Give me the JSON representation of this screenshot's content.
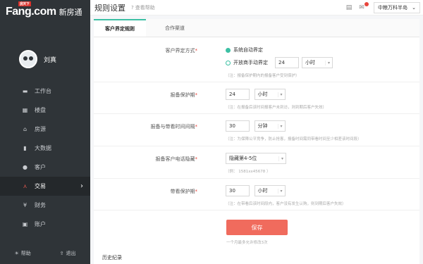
{
  "brand": {
    "tiny": "房天下",
    "name": "Fang.com",
    "sub": "新房通"
  },
  "user": {
    "name": "刘真"
  },
  "sidebar": {
    "items": [
      {
        "label": "工作台",
        "icon": "monitor-icon"
      },
      {
        "label": "楼盘",
        "icon": "building-icon"
      },
      {
        "label": "房源",
        "icon": "house-icon"
      },
      {
        "label": "大数据",
        "icon": "chart-icon"
      },
      {
        "label": "客户",
        "icon": "person-icon"
      },
      {
        "label": "交易",
        "icon": "handshake-icon",
        "active": true
      },
      {
        "label": "财务",
        "icon": "money-icon"
      },
      {
        "label": "账户",
        "icon": "account-icon"
      }
    ],
    "footer": {
      "help": "帮助",
      "logout": "退出"
    }
  },
  "header": {
    "title": "规则设置",
    "help": "查看帮助",
    "city": "中粮万科半岛"
  },
  "tabs": [
    {
      "label": "客户界定规则",
      "active": true
    },
    {
      "label": "合作渠道"
    }
  ],
  "form": {
    "define": {
      "label": "客户界定方式",
      "option1": "系统自动界定",
      "option2": "开放商手动界定",
      "value": "24",
      "unit": "小时",
      "hint": "（注：报备保护期内的报备客户受到保护）"
    },
    "protect": {
      "label": "报备保护期",
      "value": "24",
      "unit": "小时",
      "hint": "（注：在报备后该时间报客户未到访，则到期后客户失效）"
    },
    "interval": {
      "label": "报备与带看时间间隔",
      "value": "30",
      "unit": "分钟",
      "hint": "（注：为保障公平竞争，防止抢客，报备时间需同带看时间至少相差该时间段）"
    },
    "phone": {
      "label": "报备客户电话隐藏",
      "value": "隐藏第4-5位",
      "hint": "（例：  1581xx45678  ）"
    },
    "visit": {
      "label": "带看保护期",
      "value": "30",
      "unit": "小时",
      "hint": "（注：在带看后该时间段内，客户没有发生认购，则到期后客户失效）"
    },
    "save": "保存",
    "save_hint": "一个月最多允许修改3次",
    "history": "历史纪录"
  },
  "colors": {
    "accent": "#3cc0a4",
    "save": "#f06b5d",
    "sidebar": "#2f3438"
  }
}
